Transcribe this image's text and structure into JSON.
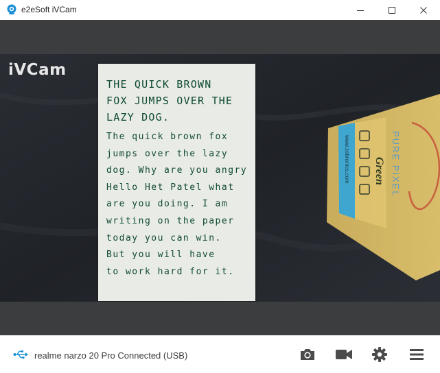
{
  "window": {
    "title": "e2eSoft iVCam",
    "icon": "camera-app-icon"
  },
  "video": {
    "watermark": "iVCam",
    "paper_heading": [
      "THE QUICK BROWN",
      "FOX JUMPS OVER THE",
      "LAZY DOG."
    ],
    "paper_body": [
      "The quick brown fox",
      "jumps over the lazy",
      "dog. Why are you angry",
      "Hello Het Patel what",
      "are you doing. I am",
      "writing on the paper",
      "today you can win.",
      "But you will have",
      "to work hard for it."
    ],
    "box_texts": [
      "PURE PIXEL",
      "Green",
      "www.zebronics.com"
    ]
  },
  "status": {
    "connection": "realme narzo 20 Pro Connected (USB)",
    "connection_icon": "usb-icon"
  },
  "toolbar": {
    "buttons": [
      "snapshot-button",
      "record-button",
      "settings-button",
      "menu-button"
    ]
  },
  "colors": {
    "accent": "#1a8fd6",
    "ink": "#0d4a2f",
    "preview_bg": "#3c3d3f",
    "toolbar_icon": "#4b4b4b"
  }
}
